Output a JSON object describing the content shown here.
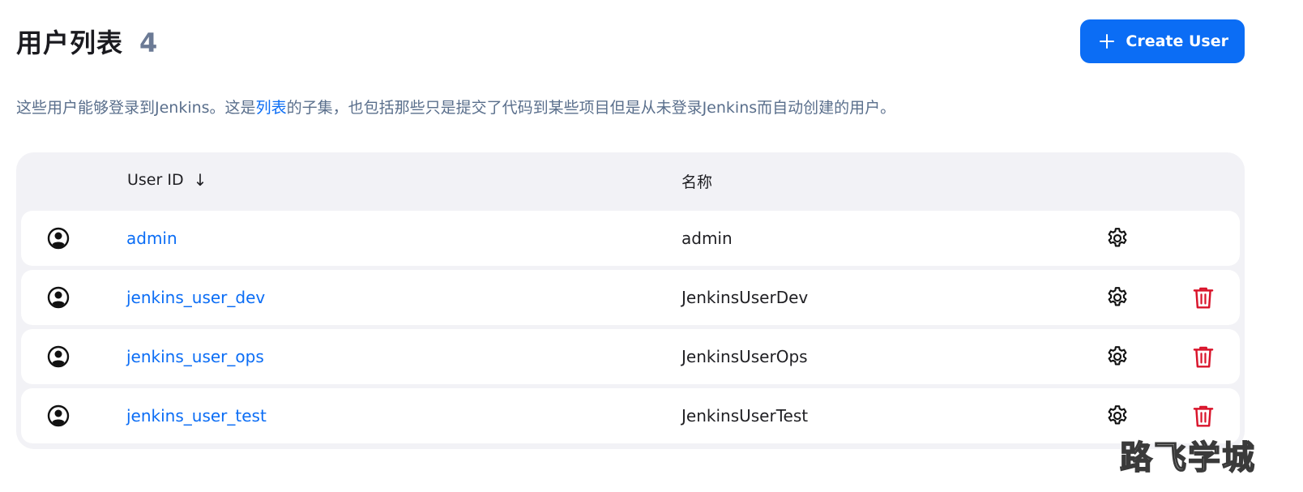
{
  "header": {
    "title": "用户列表",
    "count": "4",
    "create_button_label": "Create User"
  },
  "description": {
    "before_link": "这些用户能够登录到Jenkins。这是",
    "link_text": "列表",
    "after_link": "的子集，也包括那些只是提交了代码到某些项目但是从未登录Jenkins而自动创建的用户。"
  },
  "table": {
    "columns": {
      "user_id": "User ID",
      "sort_indicator": "↓",
      "name": "名称"
    },
    "rows": [
      {
        "user_id": "admin",
        "name": "admin",
        "deletable": false
      },
      {
        "user_id": "jenkins_user_dev",
        "name": "JenkinsUserDev",
        "deletable": true
      },
      {
        "user_id": "jenkins_user_ops",
        "name": "JenkinsUserOps",
        "deletable": true
      },
      {
        "user_id": "jenkins_user_test",
        "name": "JenkinsUserTest",
        "deletable": true
      }
    ]
  },
  "watermark": "路飞学城",
  "colors": {
    "accent": "#0b6df5",
    "danger": "#d9142b",
    "muted": "#5a6f8c"
  },
  "icons": [
    "plus-icon",
    "user-avatar-icon",
    "gear-icon",
    "trash-icon"
  ]
}
